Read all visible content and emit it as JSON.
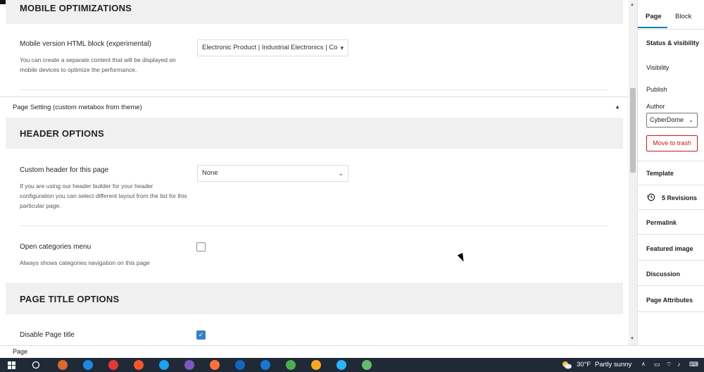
{
  "main": {
    "mobile_section": {
      "title": "MOBILE OPTIMIZATIONS",
      "mobile_html_label": "Mobile version HTML block (experimental)",
      "mobile_html_desc": "You can create a separate content that will be displayed on mobile devices to optimize the performance.",
      "mobile_html_value": "Electronic Product | Industrial Electronics | Co"
    },
    "metabox": {
      "title": "Page Setting (custom metabox from theme)"
    },
    "header_section": {
      "title": "HEADER OPTIONS",
      "custom_header_label": "Custom header for this page",
      "custom_header_desc": "If you are using our header builder for your header configuration you can select different layout from the list for this particular page.",
      "custom_header_value": "None",
      "open_categories_label": "Open categories menu",
      "open_categories_desc": "Always shows categories navigation on this page",
      "open_categories_checked": false
    },
    "title_section": {
      "title": "PAGE TITLE OPTIONS",
      "disable_title_label": "Disable Page title",
      "disable_title_checked": true
    }
  },
  "sidebar": {
    "tabs": [
      "Page",
      "Block"
    ],
    "status_heading": "Status & visibility",
    "visibility_label": "Visibility",
    "publish_label": "Publish",
    "author_label": "Author",
    "author_value": "CyberDome",
    "trash_label": "Move to trash",
    "template_label": "Template",
    "revisions_label": "5 Revisions",
    "permalink_label": "Permalink",
    "featured_image_label": "Featured image",
    "discussion_label": "Discussion",
    "page_attributes_label": "Page Attributes"
  },
  "footer": {
    "breadcrumb": "Page"
  },
  "taskbar": {
    "weather_temp": "30°F",
    "weather_desc": "Partly sunny",
    "icon_colors": [
      "#ffffff",
      "#d9692c",
      "#1e88e5",
      "#e53935",
      "#fb542b",
      "#1da1f2",
      "#7e57c2",
      "#ff7139",
      "#1565c0",
      "#1976d2",
      "#4caf50",
      "#f9a825",
      "#29b6f6",
      "#66bb6a"
    ]
  }
}
